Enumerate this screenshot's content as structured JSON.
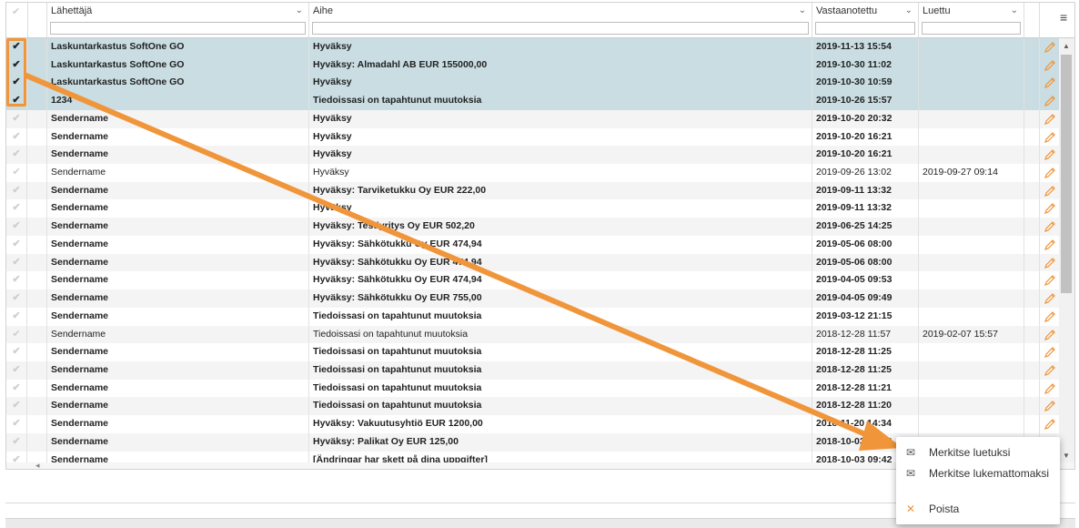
{
  "columns": [
    {
      "label": "",
      "name": "select"
    },
    {
      "label": "Lähettäjä",
      "name": "sender"
    },
    {
      "label": "Aihe",
      "name": "subject"
    },
    {
      "label": "Vastaanotettu",
      "name": "received"
    },
    {
      "label": "Luettu",
      "name": "read"
    }
  ],
  "check_glyph": "✔",
  "menu_glyph": "≡",
  "rows": [
    {
      "sender": "Laskuntarkastus SoftOne GO",
      "subject": "Hyväksy",
      "received": "2019-11-13 15:54",
      "read": "",
      "selected": true,
      "bold": true
    },
    {
      "sender": "Laskuntarkastus SoftOne GO",
      "subject": "Hyväksy: Almadahl AB EUR 155000,00",
      "received": "2019-10-30 11:02",
      "read": "",
      "selected": true,
      "bold": true
    },
    {
      "sender": "Laskuntarkastus SoftOne GO",
      "subject": "Hyväksy",
      "received": "2019-10-30 10:59",
      "read": "",
      "selected": true,
      "bold": true
    },
    {
      "sender": "1234",
      "subject": "Tiedoissasi on tapahtunut muutoksia",
      "received": "2019-10-26 15:57",
      "read": "",
      "selected": true,
      "bold": true
    },
    {
      "sender": "Sendername",
      "subject": "Hyväksy",
      "received": "2019-10-20 20:32",
      "read": "",
      "selected": false,
      "bold": true
    },
    {
      "sender": "Sendername",
      "subject": "Hyväksy",
      "received": "2019-10-20 16:21",
      "read": "",
      "selected": false,
      "bold": true
    },
    {
      "sender": "Sendername",
      "subject": "Hyväksy",
      "received": "2019-10-20 16:21",
      "read": "",
      "selected": false,
      "bold": true
    },
    {
      "sender": "Sendername",
      "subject": "Hyväksy",
      "received": "2019-09-26 13:02",
      "read": "2019-09-27 09:14",
      "selected": false,
      "bold": false
    },
    {
      "sender": "Sendername",
      "subject": "Hyväksy: Tarviketukku Oy EUR 222,00",
      "received": "2019-09-11 13:32",
      "read": "",
      "selected": false,
      "bold": true
    },
    {
      "sender": "Sendername",
      "subject": "Hyväksy",
      "received": "2019-09-11 13:32",
      "read": "",
      "selected": false,
      "bold": true
    },
    {
      "sender": "Sendername",
      "subject": "Hyväksy: Testiyritys Oy EUR 502,20",
      "received": "2019-06-25 14:25",
      "read": "",
      "selected": false,
      "bold": true
    },
    {
      "sender": "Sendername",
      "subject": "Hyväksy: Sähkötukku Oy EUR 474,94",
      "received": "2019-05-06 08:00",
      "read": "",
      "selected": false,
      "bold": true
    },
    {
      "sender": "Sendername",
      "subject": "Hyväksy: Sähkötukku Oy EUR 474,94",
      "received": "2019-05-06 08:00",
      "read": "",
      "selected": false,
      "bold": true
    },
    {
      "sender": "Sendername",
      "subject": "Hyväksy: Sähkötukku Oy EUR 474,94",
      "received": "2019-04-05 09:53",
      "read": "",
      "selected": false,
      "bold": true
    },
    {
      "sender": "Sendername",
      "subject": "Hyväksy: Sähkötukku Oy EUR 755,00",
      "received": "2019-04-05 09:49",
      "read": "",
      "selected": false,
      "bold": true
    },
    {
      "sender": "Sendername",
      "subject": "Tiedoissasi on tapahtunut muutoksia",
      "received": "2019-03-12 21:15",
      "read": "",
      "selected": false,
      "bold": true
    },
    {
      "sender": "Sendername",
      "subject": "Tiedoissasi on tapahtunut muutoksia",
      "received": "2018-12-28 11:57",
      "read": "2019-02-07 15:57",
      "selected": false,
      "bold": false
    },
    {
      "sender": "Sendername",
      "subject": "Tiedoissasi on tapahtunut muutoksia",
      "received": "2018-12-28 11:25",
      "read": "",
      "selected": false,
      "bold": true
    },
    {
      "sender": "Sendername",
      "subject": "Tiedoissasi on tapahtunut muutoksia",
      "received": "2018-12-28 11:25",
      "read": "",
      "selected": false,
      "bold": true
    },
    {
      "sender": "Sendername",
      "subject": "Tiedoissasi on tapahtunut muutoksia",
      "received": "2018-12-28 11:21",
      "read": "",
      "selected": false,
      "bold": true
    },
    {
      "sender": "Sendername",
      "subject": "Tiedoissasi on tapahtunut muutoksia",
      "received": "2018-12-28 11:20",
      "read": "",
      "selected": false,
      "bold": true
    },
    {
      "sender": "Sendername",
      "subject": "Hyväksy: Vakuutusyhtiö EUR 1200,00",
      "received": "2018-11-20 14:34",
      "read": "",
      "selected": false,
      "bold": true
    },
    {
      "sender": "Sendername",
      "subject": "Hyväksy: Palikat Oy EUR 125,00",
      "received": "2018-10-03 09:43",
      "read": "",
      "selected": false,
      "bold": true
    },
    {
      "sender": "Sendername",
      "subject": "[Ändringar har skett på dina uppgifter]",
      "received": "2018-10-03 09:42",
      "read": "",
      "selected": false,
      "bold": true
    }
  ],
  "context_menu": {
    "items": [
      {
        "label": "Merkitse luetuksi",
        "icon": "envelope-open-icon",
        "glyph": "✉"
      },
      {
        "label": "Merkitse lukemattomaksi",
        "icon": "envelope-icon",
        "glyph": "✉"
      },
      {
        "label": "Poista",
        "icon": "close-icon",
        "glyph": "✕"
      }
    ]
  },
  "colors": {
    "accent": "#f0953a",
    "selected_row": "#c9dde2"
  }
}
